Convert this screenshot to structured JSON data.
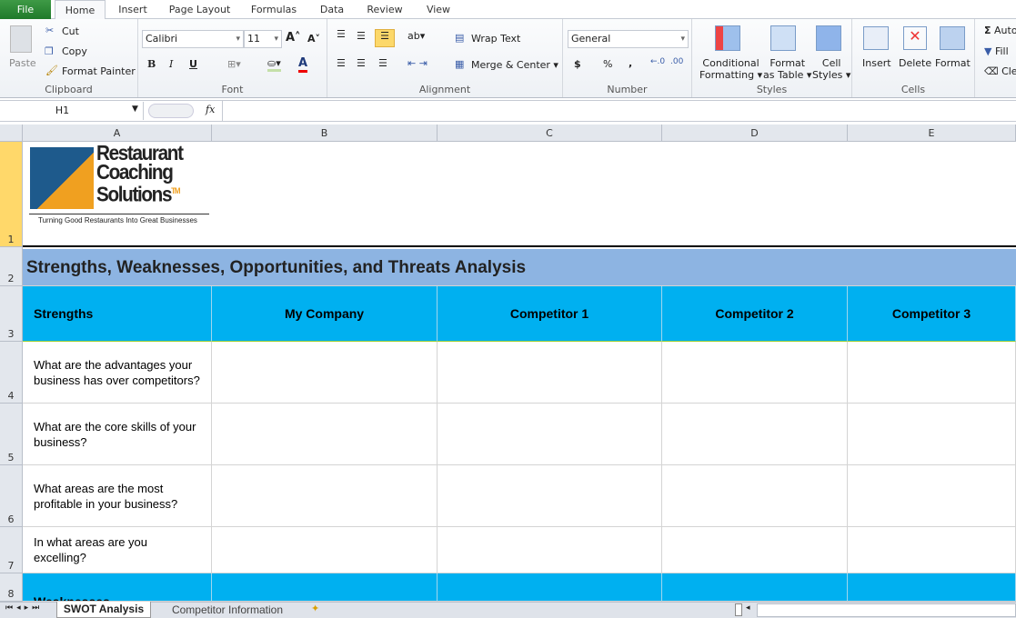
{
  "ribbon_tabs": [
    "File",
    "Home",
    "Insert",
    "Page Layout",
    "Formulas",
    "Data",
    "Review",
    "View"
  ],
  "clipboard": {
    "paste": "Paste",
    "cut": "Cut",
    "copy": "Copy",
    "format_painter": "Format Painter",
    "label": "Clipboard"
  },
  "font": {
    "name": "Calibri",
    "size": "11",
    "label": "Font",
    "bold": "B",
    "italic": "I",
    "underline": "U"
  },
  "alignment": {
    "wrap": "Wrap Text",
    "merge": "Merge & Center",
    "label": "Alignment"
  },
  "number": {
    "format": "General",
    "currency": "$",
    "percent": "%",
    "comma": ",",
    "label": "Number"
  },
  "styles": {
    "conditional": [
      "Conditional",
      "Formatting ▾"
    ],
    "table": [
      "Format",
      "as Table ▾"
    ],
    "cell": [
      "Cell",
      "Styles ▾"
    ],
    "label": "Styles"
  },
  "cells": {
    "insert": "Insert",
    "delete": "Delete",
    "format": "Format",
    "label": "Cells"
  },
  "editing": {
    "autosum": "AutoSum",
    "fill": "Fill",
    "clear": "Clear"
  },
  "formula_bar": {
    "name_box": "H1",
    "fx": "fx",
    "value": ""
  },
  "columns": [
    "A",
    "B",
    "C",
    "D",
    "E"
  ],
  "rows": [
    "1",
    "2",
    "3",
    "4",
    "5",
    "6",
    "7",
    "8"
  ],
  "logo": {
    "line1": "Restaurant",
    "line2": "Coaching",
    "line3": "Solutions",
    "tm": "TM",
    "tagline": "Turning Good Restaurants Into Great Businesses"
  },
  "sheet": {
    "title": "Strengths, Weaknesses, Opportunities, and Threats Analysis",
    "header": [
      "Strengths",
      "My Company",
      "Competitor 1",
      "Competitor 2",
      "Competitor 3"
    ],
    "questions": [
      "What are the advantages your business has over competitors?",
      "What are the core skills of your business?",
      "What areas are the most profitable in your business?",
      "In what areas are you excelling?"
    ],
    "next_section": "Weaknesses"
  },
  "sheet_tabs": [
    "SWOT Analysis",
    "Competitor Information"
  ],
  "colors": {
    "title_band": "#8db4e2",
    "header_band": "#00b0f0",
    "file_tab": "#2e8b38",
    "selected_row": "#ffd86a"
  }
}
